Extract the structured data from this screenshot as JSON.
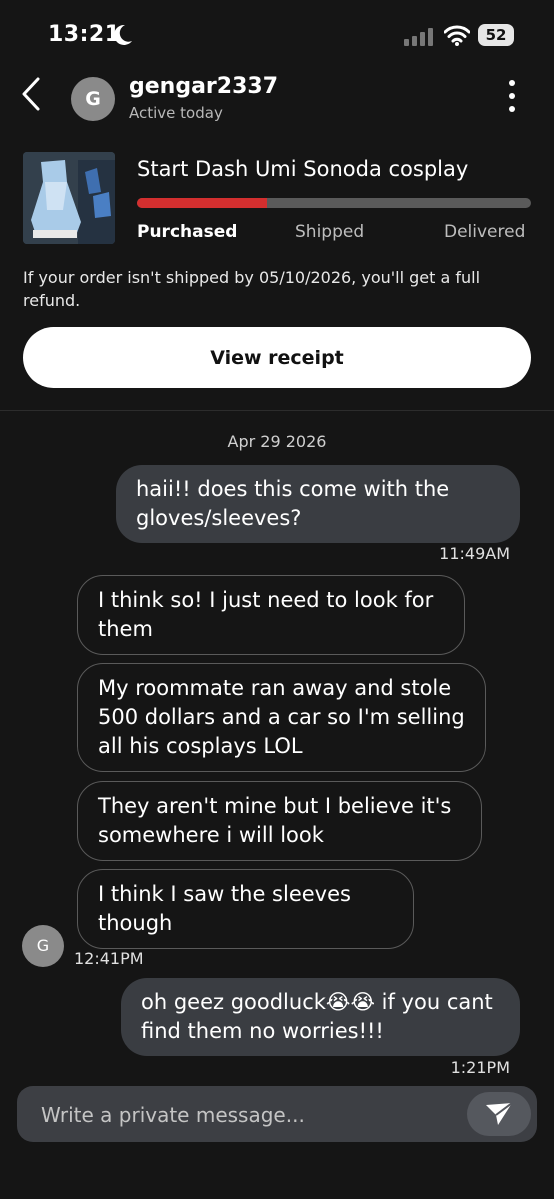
{
  "status": {
    "time": "13:21",
    "battery": "52"
  },
  "header": {
    "username": "gengar2337",
    "status": "Active today",
    "avatar_letter": "G"
  },
  "order": {
    "title": "Start Dash Umi Sonoda cosplay",
    "progress": 0.33,
    "steps": [
      "Purchased",
      "Shipped",
      "Delivered"
    ],
    "notice": "If your order isn't shipped by 05/10/2026, you'll get a full refund.",
    "receipt_label": "View receipt"
  },
  "chat": {
    "date": "Apr 29 2026",
    "messages": [
      {
        "text": "haii!! does this come with the gloves/sleeves?",
        "time": "11:49AM"
      },
      {
        "text": "I think so! I just need to look for them"
      },
      {
        "text": "My roommate ran away and stole 500 dollars and a car so I'm selling all his cosplays LOL"
      },
      {
        "text": "They aren't mine but I believe it's somewhere i will look"
      },
      {
        "text": "I think I saw the sleeves though",
        "time": "12:41PM"
      },
      {
        "text": "oh geez goodluck😭😭 if you cant find them no worries!!!",
        "time": "1:21PM"
      }
    ],
    "sender_avatar_letter": "G"
  },
  "composer": {
    "placeholder": "Write a private message..."
  },
  "icons": {
    "back": "chevron-left-icon",
    "more": "kebab-icon",
    "send": "send-icon"
  }
}
